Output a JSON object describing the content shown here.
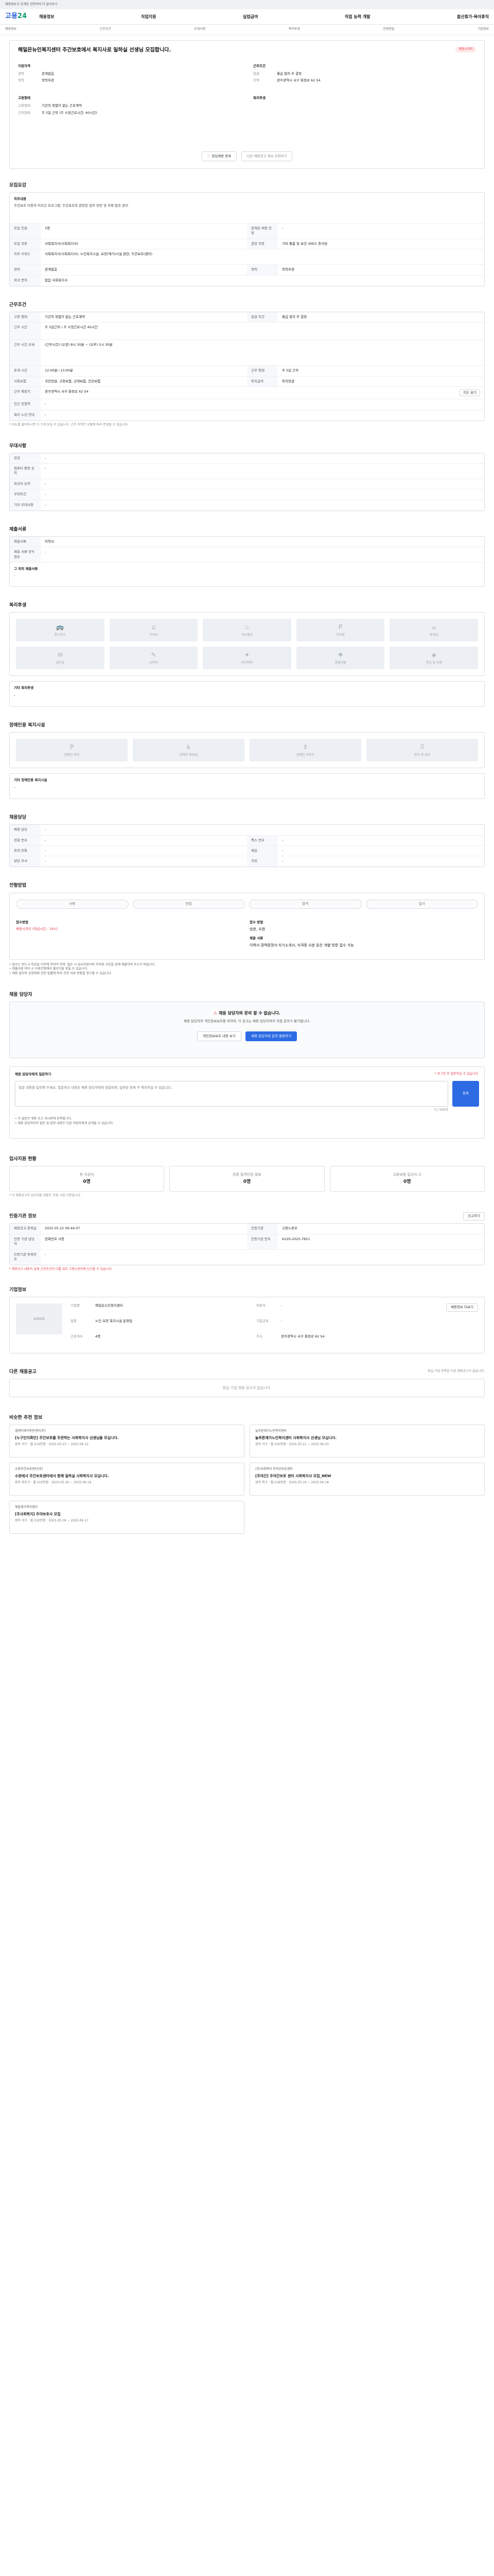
{
  "topnote": "채용정보가 공개된 관련하여 더 알아보기",
  "header": {
    "logo_a": "고용",
    "logo_b": "24",
    "gnb": [
      "채용정보",
      "직업지원",
      "실업급여",
      "직업 능력 개발",
      "출산휴가·육아휴직"
    ]
  },
  "subnav": [
    "채용정보",
    "근무조건",
    "우대사항",
    "복리후생",
    "전형방법",
    "기업정보"
  ],
  "job": {
    "title": "해밀은뉴인복지센터 주간보호에서 복지사로 일하실 선생님 모집합니다.",
    "badge": "채용시까지",
    "company_label": "지원자격",
    "company_rows": [
      {
        "k": "경력",
        "v": "관계없음"
      },
      {
        "k": "학력",
        "v": "학력무관"
      }
    ],
    "cond_label": "근무조건",
    "cond_rows": [
      {
        "k": "임금",
        "v": "월급 협의 후 결정"
      },
      {
        "k": "지역",
        "v": "광주광역시 서구 화정로 62 S4"
      }
    ],
    "emp_label": "고용형태",
    "emp_rows": [
      {
        "k": "고용형태",
        "v": "기간의 정함이 없는 근로계약"
      },
      {
        "k": "근무형태",
        "v": "주 5일 근무 (주 소정근로시간: 40시간)"
      }
    ],
    "welfare_label": "복리후생",
    "apply_btn": "관심채용 등록",
    "share_btn": "다른 채용공고 정보 조회하기"
  },
  "recruit": {
    "section": "모집요강",
    "duty_label": "직무내용",
    "duty_text": "주간보호 이용자 어르신 프로그램, 주간보호와 관련된 업무 전반 및 차량 탑승 관리",
    "rows": [
      [
        "모집 인원",
        "1명",
        "관계된 채용 인원",
        "-"
      ],
      [
        "모집 직종",
        "사회복지사(사회복지사)",
        "관련 직종",
        "기타 돌봄 및 보건 서비스 종사원"
      ],
      [
        "직무 키워드",
        "사회복지사(사회복지사), 노인복지시설, 요양(재가)시설 관련, 주간보호(센터)",
        "",
        ""
      ],
      [
        "경력",
        "관계없음",
        "학력",
        "학력무관"
      ],
      [
        "외국 면허",
        "없음 사회복지사",
        "",
        ""
      ]
    ]
  },
  "work": {
    "section": "근무조건",
    "rows": [
      [
        "고용 형태",
        "기간의 정함이 없는 근로계약",
        "임금 조건",
        "월급 협의 후 결정"
      ],
      [
        "근무 시간",
        "주 5일근무 / 주 소정근로시간 40시간",
        "",
        ""
      ],
      [
        "근무 시간 상세",
        "(근무시간) (오전) 8시 30분 ~ (오후) 5시 30분",
        "",
        ""
      ],
      [
        "휴게 시간",
        "12:00분~13:00분",
        "근무 형태",
        "주 5일 근무"
      ],
      [
        "사회보험",
        "국민연금, 고용보험, 산재보험, 건강보험",
        "퇴직급여",
        "퇴직연금"
      ],
      [
        "근무 예정지",
        "광주광역시 서구 화정로 62 S4",
        "",
        ""
      ],
      [
        "인근 전철역",
        "-",
        "",
        ""
      ],
      [
        "복리 노선 안내",
        "-",
        "",
        ""
      ]
    ],
    "note": "* 지도를 클릭하시면 더 크게 보실 수 있습니다. 근무 지역은 상황에 따라 변경될 수 있습니다.",
    "map_btn": "지도 보기"
  },
  "prefer": {
    "section": "우대사항",
    "rows": [
      [
        "전공",
        "-"
      ],
      [
        "컴퓨터 활용 능력",
        "-"
      ],
      [
        "외국어 능력",
        "-"
      ],
      [
        "우대조건",
        "-"
      ],
      [
        "기타 우대사항",
        "-"
      ]
    ]
  },
  "docs": {
    "section": "제출서류",
    "rows": [
      [
        "제출서류",
        "이력서"
      ],
      [
        "제출 서류 양식 첨부",
        "-"
      ]
    ],
    "sub": "그 외의 제출서류",
    "sub_val": "-"
  },
  "welfare": {
    "section": "복리후생",
    "items": [
      "통근버스",
      "기숙사",
      "식사제공",
      "주차장",
      "휴게실",
      "경조금",
      "교육비",
      "자녀학비",
      "명절선물",
      "연금 및 보험"
    ],
    "etc_label": "기타 복리후생",
    "etc_val": "-"
  },
  "disabled": {
    "section": "장애인용 복지시설",
    "items": [
      "장애인 주차",
      "장애인 화장실",
      "장애인 리프트",
      "점자 및 경보"
    ],
    "etc_label": "기타 장애인용 복지시설",
    "etc_val": "-"
  },
  "contact": {
    "section": "채용담당",
    "rows": [
      [
        "채용 담당",
        "-",
        "",
        ""
      ],
      [
        "전화 번호",
        "-",
        "팩스 번호",
        "-"
      ],
      [
        "휴대 전화",
        "-",
        "메일",
        "-"
      ],
      [
        "담당 부서",
        "-",
        "직위",
        "-"
      ]
    ]
  },
  "process": {
    "section": "전형방법",
    "steps": [
      "서류",
      "면접",
      "합격",
      "입사"
    ],
    "apply_method_label": "접수방법",
    "apply_method_val": "채용시까지 (마감시간 : 18시)",
    "method_label": "접수 방법",
    "method_val": "방문, 우편",
    "detail_label": "제출 서류",
    "detail_val": "이력서·경력증명서·자기소개서, 자격증 사본 등은 개별 방문 접수 가능",
    "notes": [
      "• 접수는 반드시 마감일 이전에 하여야 하며, 접수 시 입사지원서와 자격증 사본을 함께 제출하여 주시기 바랍니다.",
      "• 제출서류 미비 시 서류전형에서 불이익을 받을 수 있습니다.",
      "• 채용 절차의 공정화에 관한 법률에 따라 관련 서류 반환을 청구할 수 있습니다."
    ]
  },
  "qna": {
    "section": "채용 담당자",
    "alert_title": "채용 담당자와 문의 할 수 없습니다.",
    "alert_text": "채용 담당자의 개인정보보호를 위하여, 이 공고는 채용 담당자와의 직접 문의가 불가합니다.",
    "btn1": "개인정보보호 내용 보기",
    "btn2": "채용 담당자와 문의 불편하기",
    "ask_label": "채용 담당자에게 질문하기",
    "ask_note": "* 로그인 후 질문하실 수 있습니다.",
    "placeholder": "질문 내용을 입력해 주세요. 질문하신 내용은 채용 담당자에게 전달되며, 답변은 등록 후 확인하실 수 있습니다.",
    "count": "0 / 500자",
    "submit": "등록",
    "foot1": "• 이 질문은 채용 공고 게시판에 등록됩니다.",
    "foot2": "• 채용 담당자와의 질문 및 답변 내용은 다른 지원자에게 공개될 수 있습니다."
  },
  "stats": {
    "section": "입사지원 현황",
    "items": [
      {
        "label": "총 지원자",
        "value": "0명"
      },
      {
        "label": "최종 합격인원 발표",
        "value": "0명"
      },
      {
        "label": "고용보험 입사자 수",
        "value": "0명"
      }
    ],
    "note": "* 이 채용공고의 입사지원 현황은 지원 시점 기준입니다."
  },
  "meta": {
    "section": "인증기관 정보",
    "report_btn": "신고하기",
    "rows": [
      [
        "채용공고 등록일",
        "2025.05.22 09:44:07",
        "인증기관",
        "고용노동부"
      ],
      [
        "인증 기관 담당자",
        "전화번호 사용",
        "인증기관 번호",
        "K220-2025-7821"
      ],
      [
        "인증기관 등록번호",
        "-",
        "",
        ""
      ]
    ],
    "warn": "* 채용공고 내용과 실제 근로조건이 다를 경우 고용노동부에 신고할 수 있습니다."
  },
  "company": {
    "section": "기업정보",
    "logo_text": "LOGO",
    "name_label": "기업명",
    "name_val": "해밀은뉴인복지센터",
    "ceo_label": "대표자",
    "ceo_val": "-",
    "type_label": "업종",
    "type_val": "노인 요양 복지시설 운영업",
    "size_label": "기업규모",
    "size_val": "-",
    "emp_label": "근로자수",
    "emp_val": "4명",
    "addr_label": "주소",
    "addr_val": "광주광역시 서구 화정로 62 S4",
    "page_btn": "채용정보 더보기"
  },
  "others": {
    "section": "다른 채용공고",
    "sub": "동일 기업 등록된 다른 채용공고가 없습니다.",
    "empty": "동일 기업 채용 공고가 없습니다."
  },
  "recommend": {
    "section": "비슷한 추천 정보",
    "cards": [
      {
        "co": "엘에이재가방문센터(주)",
        "title": "[누구인지확인] 주간보호를 주관하는 사회복지사 선생님을 모십니다.",
        "meta": "광주 서구 · 월 214만원 · 2025.05.23 ~ 2025.06.22"
      },
      {
        "co": "늘푸른재가노인복지센터",
        "title": "늘푸른재가노인복지센터 사회복지사 선생님 모십니다.",
        "meta": "광주 서구 · 월 220만원 · 2025.05.21 ~ 2025.06.20"
      },
      {
        "co": "수완주간보호센터(주)",
        "title": "수완에서 주간보호센터에서 함께 일하실 사회복지사 모십니다.",
        "meta": "광주 광산구 · 월 215만원 · 2025.05.20 ~ 2025.06.19"
      },
      {
        "co": "(주)사회복지 주야간보호센터",
        "title": "[주야간] 주야간보호 센터 사회복지사 모집_NEW",
        "meta": "광주 북구 · 월 218만원 · 2025.05.19 ~ 2025.06.18"
      },
      {
        "co": "해밀재가복지센터",
        "title": "[주사회복지] 주야보호사 모집",
        "meta": "광주 서구 · 월 210만원 · 2025.05.18 ~ 2025.06.17"
      }
    ]
  }
}
